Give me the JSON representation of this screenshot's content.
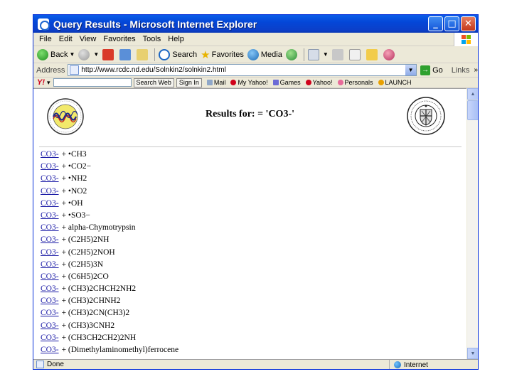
{
  "window": {
    "title": "Query Results - Microsoft Internet Explorer"
  },
  "menu": [
    "File",
    "Edit",
    "View",
    "Favorites",
    "Tools",
    "Help"
  ],
  "toolbar": {
    "back": "Back",
    "search": "Search",
    "favorites": "Favorites",
    "media": "Media"
  },
  "address": {
    "label": "Address",
    "url": "http://www.rcdc.nd.edu/Solnkin2/solnkin2.html",
    "go": "Go",
    "links": "Links",
    "more": "»"
  },
  "yahoo": {
    "logo": "Y!",
    "search_web": "Search Web",
    "sign_in": "Sign In",
    "mail": "Mail",
    "my_yahoo": "My Yahoo!",
    "games": "Games",
    "yahoo": "Yahoo!",
    "personals": "Personals",
    "launch": "LAUNCH"
  },
  "page": {
    "title": "Results for: = 'CO3-'",
    "link_label": "CO3-",
    "rows": [
      "+ •CH3",
      "+ •CO2−",
      "+ •NH2",
      "+ •NO2",
      "+ •OH",
      "+ •SO3−",
      "+ alpha-Chymotrypsin",
      "+ (C2H5)2NH",
      "+ (C2H5)2NOH",
      "+ (C2H5)3N",
      "+ (C6H5)2CO",
      "+ (CH3)2CHCH2NH2",
      "+ (CH3)2CHNH2",
      "+ (CH3)2CN(CH3)2",
      "+ (CH3)3CNH2",
      "+ (CH3CH2CH2)2NH",
      "+ (Dimethylaminomethyl)ferrocene"
    ]
  },
  "status": {
    "left": "Done",
    "zone": "Internet"
  }
}
